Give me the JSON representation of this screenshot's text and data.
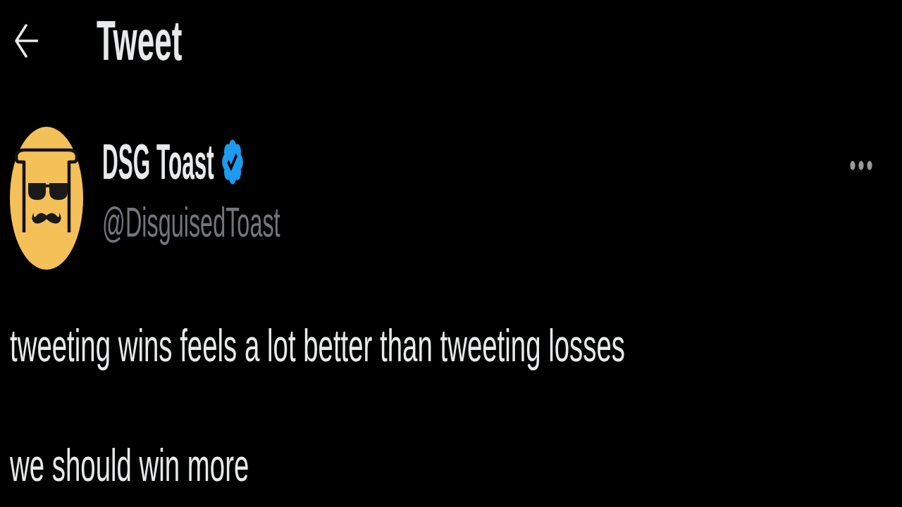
{
  "header": {
    "title": "Tweet"
  },
  "tweet": {
    "author": {
      "name": "DSG Toast",
      "verified": true,
      "handle": "@DisguisedToast"
    },
    "paragraphs": [
      "tweeting wins feels a lot better than tweeting losses",
      "we should win more"
    ]
  }
}
